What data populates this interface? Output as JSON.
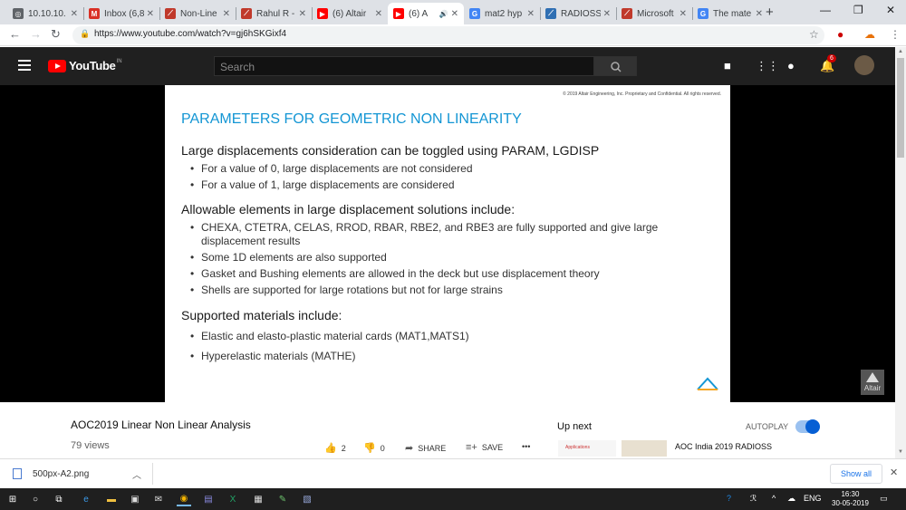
{
  "browser": {
    "tabs": [
      {
        "label": "10.10.10.",
        "favicon": "globe-icon",
        "color": "#5f6368"
      },
      {
        "label": "Inbox (6,8",
        "favicon": "gmail-icon",
        "color": "#d93025"
      },
      {
        "label": "Non-Line",
        "favicon": "altair-icon",
        "color": "#c0392b"
      },
      {
        "label": "Rahul R -",
        "favicon": "altair-icon",
        "color": "#c0392b"
      },
      {
        "label": "(6) Altair",
        "favicon": "youtube-icon",
        "color": "#ff0000"
      },
      {
        "label": "(6) A",
        "favicon": "youtube-icon",
        "color": "#ff0000",
        "active": true
      },
      {
        "label": "mat2 hyp",
        "favicon": "google-icon",
        "color": "#4285f4"
      },
      {
        "label": "RADIOSS",
        "favicon": "altair-icon",
        "color": "#2f6fb3"
      },
      {
        "label": "Microsoft",
        "favicon": "altair-icon",
        "color": "#c0392b"
      },
      {
        "label": "The mate",
        "favicon": "google-icon",
        "color": "#4285f4"
      }
    ],
    "new_tab": "+",
    "url": "https://www.youtube.com/watch?v=gj6hSKGixf4"
  },
  "youtube": {
    "logo_text": "YouTube",
    "country": "IN",
    "search_placeholder": "Search",
    "notification_count": "6"
  },
  "slide": {
    "copyright": "© 2019 Altair Engineering, Inc. Proprietary and Confidential. All rights reserved.",
    "title": "PARAMETERS FOR GEOMETRIC NON LINEARITY",
    "heading1": "Large displacements consideration can be toggled using PARAM, LGDISP",
    "bullets1": [
      "For a value of 0, large displacements are not considered",
      "For a value of 1, large displacements are considered"
    ],
    "heading2": "Allowable elements in large displacement solutions include:",
    "bullets2": [
      "CHEXA, CTETRA, CELAS, RROD, RBAR, RBE2, and RBE3 are fully supported and give large displacement results",
      "Some 1D elements are also supported",
      "Gasket and Bushing elements are allowed in the deck but use displacement theory",
      "Shells are supported for large rotations but not for large strains"
    ],
    "heading3": "Supported materials include:",
    "bullets3": [
      "Elastic and elasto-plastic material cards (MAT1,MATS1)",
      "Hyperelastic materials (MATHE)"
    ],
    "watermark": "Altair"
  },
  "video": {
    "title": "AOC2019 Linear Non Linear Analysis",
    "views": "79 views",
    "likes": "2",
    "dislikes": "0",
    "share": "SHARE",
    "save": "SAVE",
    "more": "•••"
  },
  "sidebar": {
    "up_next": "Up next",
    "autoplay": "AUTOPLAY",
    "autoplay_on": true,
    "next_thumb_text": "Applications",
    "next_title": "AOC India 2019 RADIOSS"
  },
  "downloads": {
    "file": "500px-A2.png",
    "show_all": "Show all"
  },
  "taskbar": {
    "lang": "ENG",
    "time": "16:30",
    "date": "30-05-2019"
  }
}
